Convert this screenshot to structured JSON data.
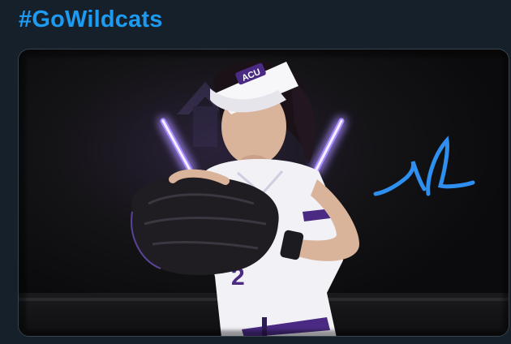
{
  "tweet": {
    "hashtag": "#GoWildcats"
  },
  "media": {
    "description_icon": "photo",
    "visor_logo_text": "ACU",
    "jersey_number": "2",
    "signature_text": "JL",
    "colors": {
      "background": "#15202b",
      "link_blue": "#1d9bf0",
      "card_border": "#38444d",
      "neon_purple": "#8b5cf6",
      "signature_blue": "#2f8ff0",
      "jersey_white": "#f2f1f6",
      "team_purple": "#4b2a83"
    }
  }
}
